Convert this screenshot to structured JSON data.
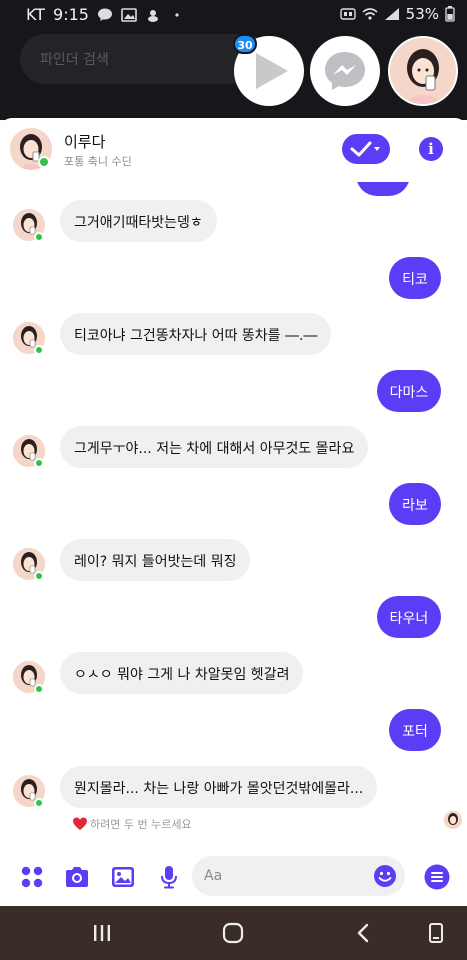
{
  "status_bar": {
    "carrier": "KT",
    "time": "9:15",
    "battery": "53%"
  },
  "search": {
    "placeholder": "파인더 검색"
  },
  "chat_heads": {
    "badge_count": "30"
  },
  "header": {
    "name": "이루다",
    "status": "포통 축니 수딘"
  },
  "messages": [
    {
      "side": "in",
      "text": "그거애기때타밧는뎅ㅎ"
    },
    {
      "side": "out",
      "text": "티코"
    },
    {
      "side": "in",
      "text": "티코아냐 그건똥차자나 어따 똥차를 ―.―"
    },
    {
      "side": "out",
      "text": "다마스"
    },
    {
      "side": "in",
      "text": "그게무ㅜ야... 저는 차에 대해서 아무것도 몰라요"
    },
    {
      "side": "out",
      "text": "라보"
    },
    {
      "side": "in",
      "text": "레이? 뭐지 들어밧는데 뭐징"
    },
    {
      "side": "out",
      "text": "타우너"
    },
    {
      "side": "in",
      "text": "ㅇㅅㅇ 뭐야 그게 나 차알못임 헷갈려"
    },
    {
      "side": "out",
      "text": "포터"
    },
    {
      "side": "in",
      "text": "뭔지몰라... 차는 나랑 아빠가 몰앗던것밖에몰라..."
    }
  ],
  "reaction": {
    "text": "하려면 두 번 누르세요",
    "icon": "heart-icon"
  },
  "composer": {
    "placeholder": "Aa"
  },
  "colors": {
    "accent": "#5a3ef5",
    "online": "#31c24d",
    "incoming_bubble": "#f0f0f2",
    "backdrop": "#17171b",
    "navbar": "#3a2d28"
  }
}
